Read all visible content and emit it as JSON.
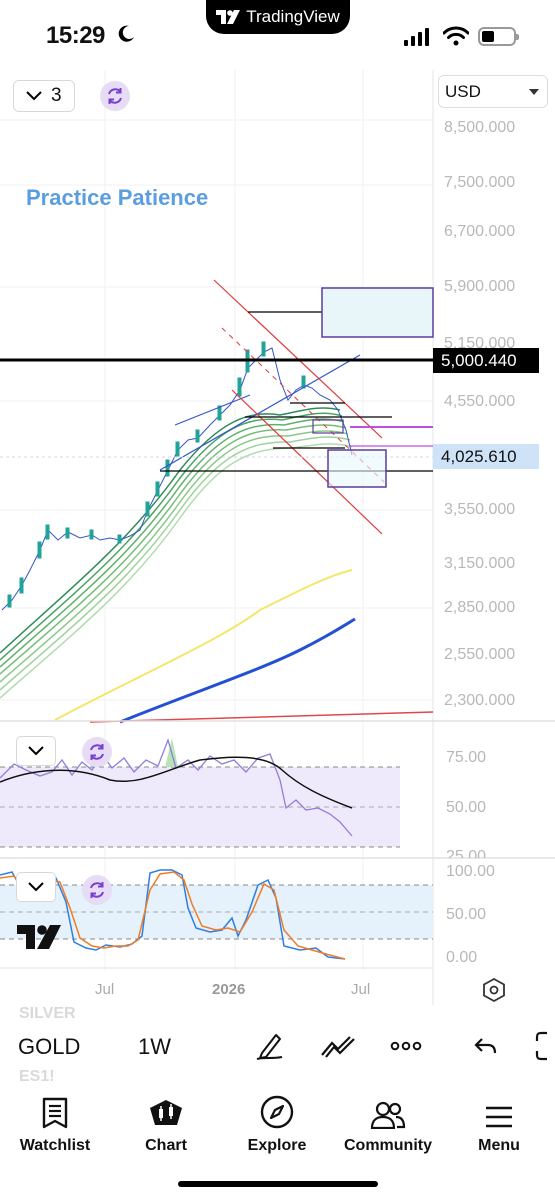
{
  "status_bar": {
    "time": "15:29",
    "island_label": "TradingView"
  },
  "header": {
    "interval_count": "3",
    "currency": "USD"
  },
  "annotation": "Practice Patience",
  "price_axis": [
    "8,500.000",
    "7,500.000",
    "6,700.000",
    "5,900.000",
    "5,150.000",
    "4,550.000",
    "3,550.000",
    "3,150.000",
    "2,850.000",
    "2,550.000",
    "2,300.000"
  ],
  "price_tags": {
    "horizontal_line": "5,000.440",
    "last_price": "4,025.610"
  },
  "rsi_axis": [
    "75.00",
    "50.00",
    "25.00"
  ],
  "stoch_axis": [
    "100.00",
    "50.00",
    "0.00"
  ],
  "time_axis": [
    "Jul",
    "2026",
    "Jul"
  ],
  "ticker_bar": {
    "prev_symbol": "SILVER",
    "symbol": "GOLD",
    "timeframe": "1W",
    "next_symbol": "ES1!"
  },
  "tools": [
    "draw-tool-icon",
    "line-tools-icon",
    "more-icon",
    "undo-icon"
  ],
  "tabs": [
    {
      "label": "Watchlist",
      "icon": "watchlist-icon"
    },
    {
      "label": "Chart",
      "icon": "chart-icon"
    },
    {
      "label": "Explore",
      "icon": "compass-icon"
    },
    {
      "label": "Community",
      "icon": "community-icon"
    },
    {
      "label": "Menu",
      "icon": "menu-icon"
    }
  ],
  "colors": {
    "candle_up": "#22a39a",
    "candle_outline": "#3355cc",
    "resistance_line": "#000000",
    "channel": "#e23b3b",
    "ma_yellow": "#f5e66a",
    "ma_blue": "#2451d4",
    "ribbon": "#7cc47a",
    "rsi_line": "#8c7fd8",
    "stoch_k": "#2f7fe0",
    "stoch_d": "#f07c26",
    "accent_purple": "#9b59d8"
  }
}
